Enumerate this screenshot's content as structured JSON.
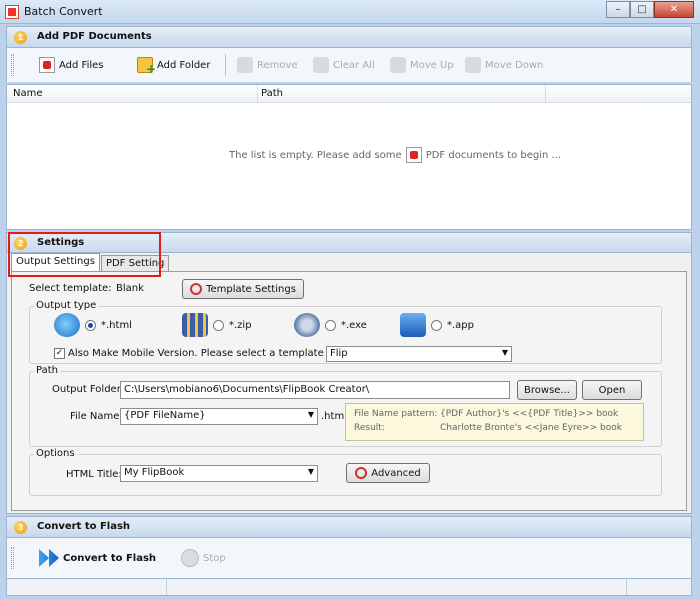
{
  "window": {
    "title": "Batch Convert",
    "minimize": "–",
    "maximize": "□",
    "close": "✕"
  },
  "section1": {
    "number": "1",
    "title": "Add PDF Documents"
  },
  "toolbar": {
    "add_files": "Add Files",
    "add_folder": "Add Folder",
    "remove": "Remove",
    "clear_all": "Clear All",
    "move_up": "Move Up",
    "move_down": "Move Down"
  },
  "list": {
    "columns": [
      "Name",
      "Path"
    ],
    "empty_before": "The list is empty. Please add some",
    "empty_after": "PDF documents to begin ..."
  },
  "section2": {
    "number": "2",
    "title": "Settings"
  },
  "tabs": [
    "Output Settings",
    "PDF Setting"
  ],
  "template": {
    "label": "Select template:",
    "value": "Blank",
    "button": "Template Settings"
  },
  "output_type": {
    "title": "Output type",
    "options": [
      {
        "label": "*.html",
        "selected": true,
        "icon": "html-globe-icon"
      },
      {
        "label": "*.zip",
        "selected": false,
        "icon": "zip-archive-icon"
      },
      {
        "label": "*.exe",
        "selected": false,
        "icon": "exe-gear-icon"
      },
      {
        "label": "*.app",
        "selected": false,
        "icon": "mac-app-icon"
      }
    ],
    "mobile_label": "Also Make Mobile Version. Please select a template for mobile:",
    "mobile_checked": true,
    "mobile_template": "Flip"
  },
  "path": {
    "title": "Path",
    "output_folder_label": "Output Folder:",
    "output_folder_value": "C:\\Users\\mobiano6\\Documents\\FlipBook Creator\\",
    "browse": "Browse...",
    "open": "Open",
    "file_name_label": "File Name:",
    "file_name_value": "{PDF FileName}",
    "extension": ".html",
    "pattern_label": "File Name pattern:",
    "pattern_value": "{PDF Author}'s <<{PDF Title}>> book",
    "result_label": "Result:",
    "result_value": "Charlotte Bronte's <<Jane Eyre>> book"
  },
  "options": {
    "title": "Options",
    "html_title_label": "HTML Title:",
    "html_title_value": "My FlipBook",
    "advanced": "Advanced"
  },
  "section3": {
    "number": "3",
    "title": "Convert to Flash"
  },
  "bottom": {
    "convert": "Convert to Flash",
    "stop": "Stop"
  },
  "colors": {
    "highlight": "#e21b1b",
    "section_bg": "#c7d8ee",
    "accent": "#f19a09"
  }
}
